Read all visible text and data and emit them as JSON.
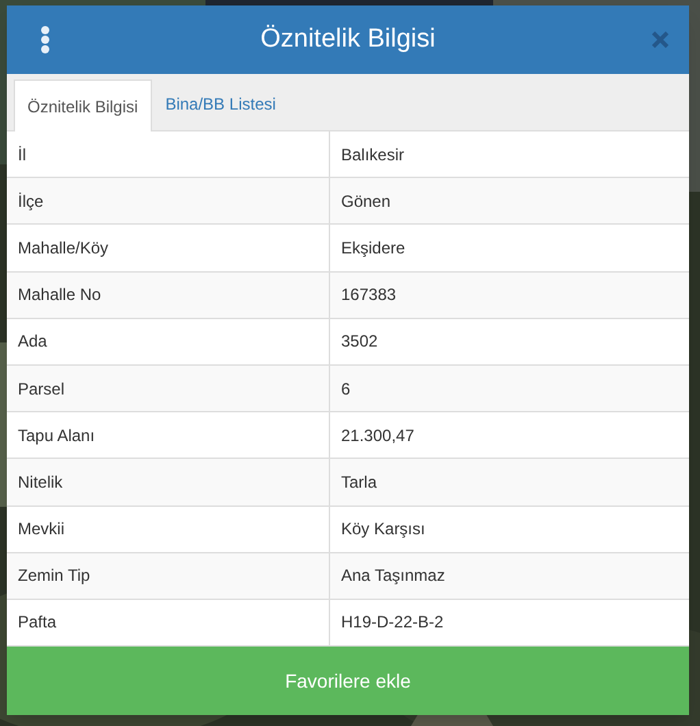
{
  "dialog": {
    "title": "Öznitelik Bilgisi"
  },
  "tabs": [
    {
      "label": "Öznitelik Bilgisi",
      "selected": true
    },
    {
      "label": "Bina/BB Listesi",
      "selected": false
    }
  ],
  "rows": [
    {
      "label": "İl",
      "value": "Balıkesir"
    },
    {
      "label": "İlçe",
      "value": "Gönen"
    },
    {
      "label": "Mahalle/Köy",
      "value": "Ekşidere"
    },
    {
      "label": "Mahalle No",
      "value": "167383"
    },
    {
      "label": "Ada",
      "value": "3502"
    },
    {
      "label": "Parsel",
      "value": "6"
    },
    {
      "label": "Tapu Alanı",
      "value": "21.300,47"
    },
    {
      "label": "Nitelik",
      "value": "Tarla"
    },
    {
      "label": "Mevkii",
      "value": "Köy Karşısı"
    },
    {
      "label": "Zemin Tip",
      "value": "Ana Taşınmaz"
    },
    {
      "label": "Pafta",
      "value": "H19-D-22-B-2"
    }
  ],
  "button": {
    "label": "Favorilere ekle"
  }
}
